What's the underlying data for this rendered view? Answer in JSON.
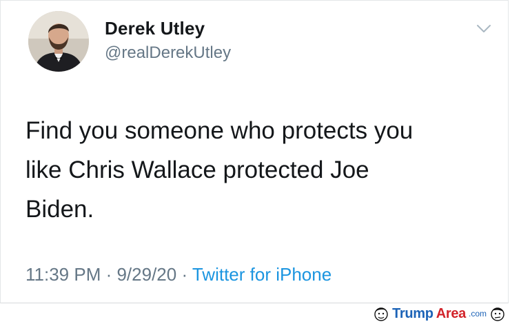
{
  "tweet": {
    "author": {
      "display_name": "Derek Utley",
      "handle": "@realDerekUtley",
      "avatar_icon": "profile-photo"
    },
    "text": "Find you someone who protects you\nlike Chris Wallace protected Joe\nBiden.",
    "time": "11:39 PM",
    "separator": " · ",
    "date": "9/29/20",
    "source": "Twitter for iPhone",
    "menu_icon": "chevron-down-icon"
  },
  "watermark": {
    "trump": "Trump",
    "area": "Area",
    "tld": ".com"
  },
  "colors": {
    "text": "#14171a",
    "secondary": "#657786",
    "link": "#1b95e0",
    "watermark_blue": "#1c63b7",
    "watermark_red": "#d2232a"
  }
}
